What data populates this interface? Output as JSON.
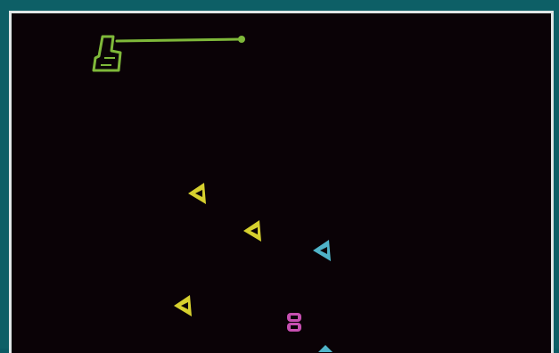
{
  "game": {
    "view": "playfield",
    "colors": {
      "background": "#0a0206",
      "border": "#dfe6e6",
      "frame": "#0d5f66",
      "player_green": "#7fb83a",
      "enemy_yellow": "#d6d02e",
      "enemy_cyan": "#4fb3c8",
      "enemy_magenta": "#c64fb0"
    },
    "entities": [
      {
        "kind": "player-cannon",
        "color": "player_green",
        "icon": "cannon-icon"
      },
      {
        "kind": "enemy-ship",
        "color": "enemy_yellow",
        "icon": "triangle-ship-icon"
      },
      {
        "kind": "enemy-ship",
        "color": "enemy_yellow",
        "icon": "triangle-ship-icon"
      },
      {
        "kind": "enemy-ship",
        "color": "enemy_cyan",
        "icon": "triangle-ship-icon"
      },
      {
        "kind": "enemy-ship",
        "color": "enemy_yellow",
        "icon": "triangle-ship-icon"
      },
      {
        "kind": "enemy-creature",
        "color": "enemy_magenta",
        "icon": "creature-icon"
      }
    ]
  }
}
